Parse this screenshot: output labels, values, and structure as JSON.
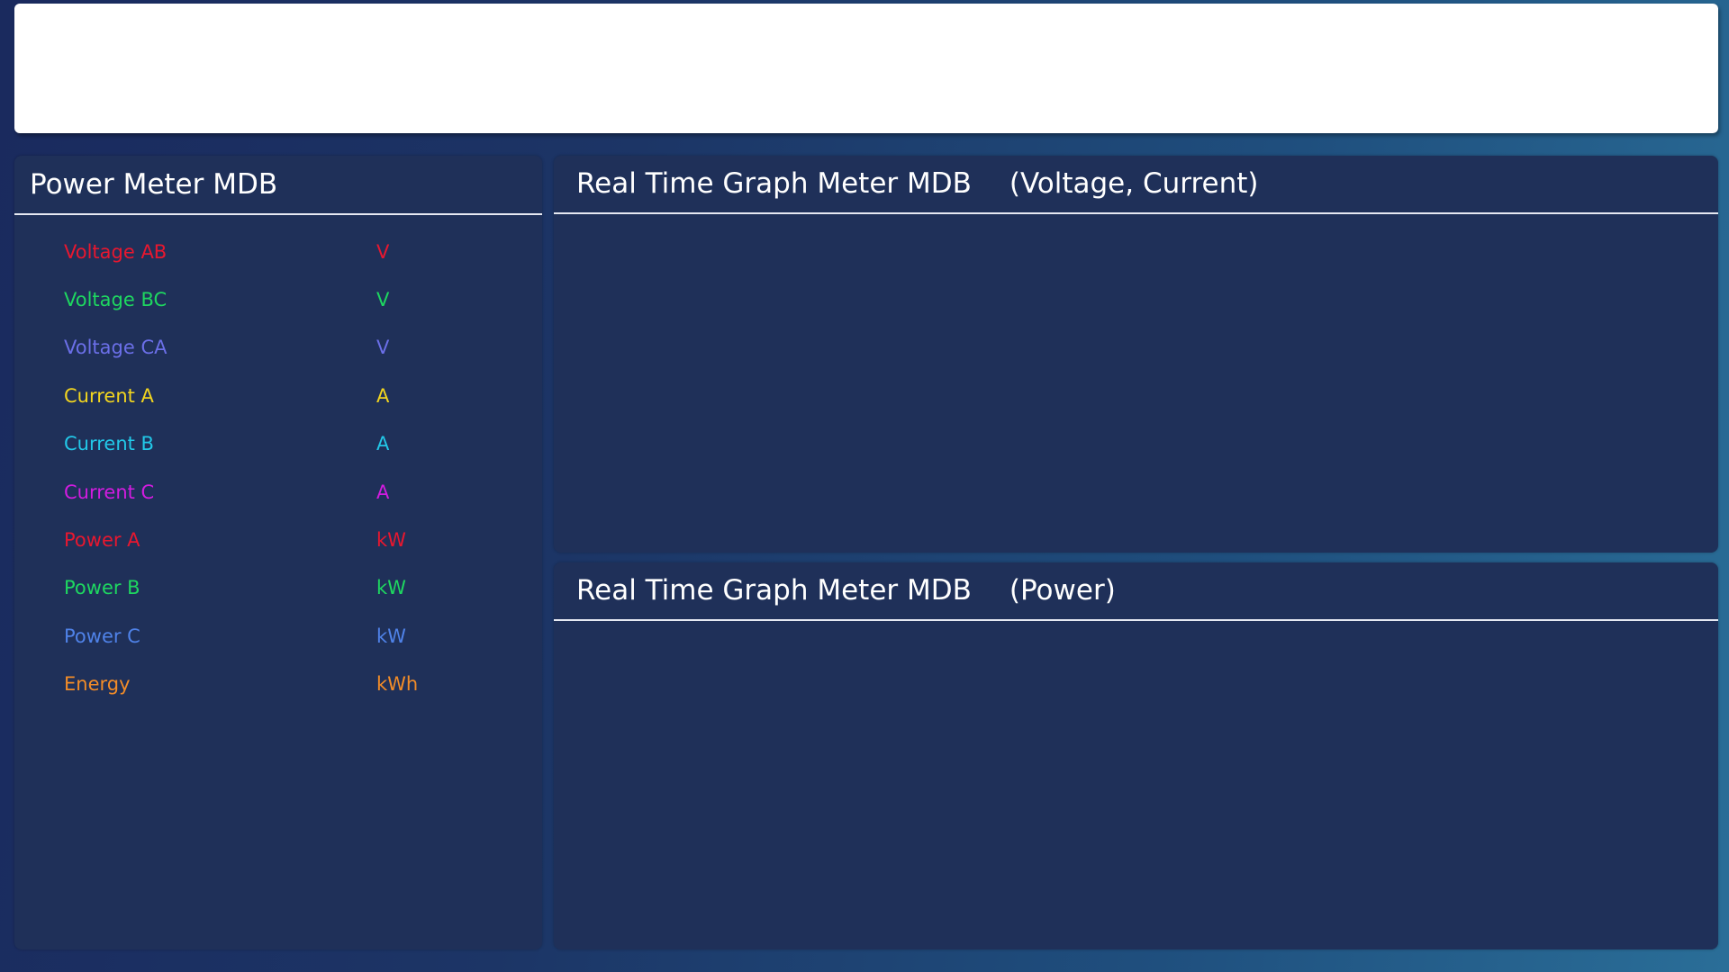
{
  "meter_panel": {
    "title": "Power Meter MDB",
    "rows": [
      {
        "label": "Voltage AB",
        "value": "",
        "unit": "V",
        "color": "#e8172f"
      },
      {
        "label": "Voltage BC",
        "value": "",
        "unit": "V",
        "color": "#1ed760"
      },
      {
        "label": "Voltage CA",
        "value": "",
        "unit": "V",
        "color": "#6b6fe8"
      },
      {
        "label": "Current A",
        "value": "",
        "unit": "A",
        "color": "#f2d51f"
      },
      {
        "label": "Current B",
        "value": "",
        "unit": "A",
        "color": "#22c8e8"
      },
      {
        "label": "Current C",
        "value": "",
        "unit": "A",
        "color": "#d21ce0"
      },
      {
        "label": "Power A",
        "value": "",
        "unit": "kW",
        "color": "#e8172f"
      },
      {
        "label": "Power B",
        "value": "",
        "unit": "kW",
        "color": "#1ed760"
      },
      {
        "label": "Power C",
        "value": "",
        "unit": "kW",
        "color": "#4f82e8"
      },
      {
        "label": "Energy",
        "value": "",
        "unit": "kWh",
        "color": "#f28c28"
      }
    ]
  },
  "graph_voltage_current": {
    "title": "Real Time Graph Meter MDB",
    "subtitle": "(Voltage, Current)"
  },
  "graph_power": {
    "title": "Real Time Graph Meter MDB",
    "subtitle": "(Power)"
  }
}
